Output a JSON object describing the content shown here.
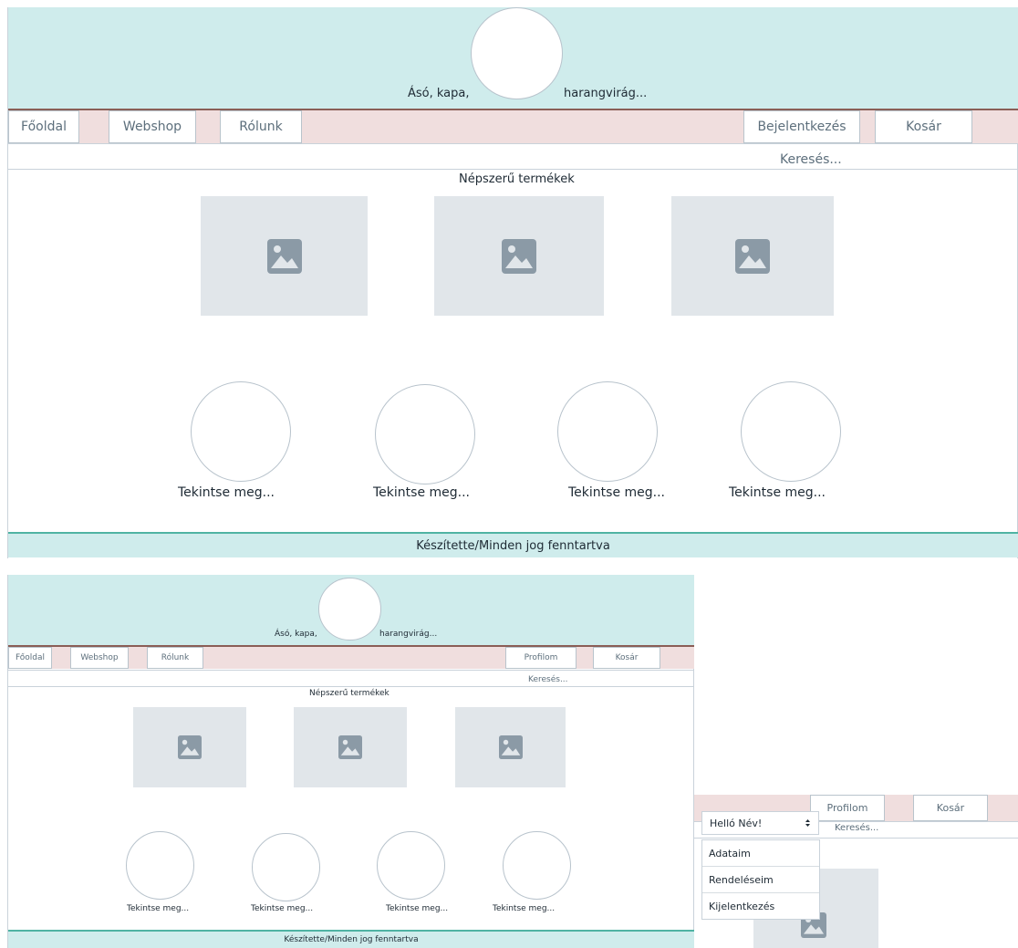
{
  "header": {
    "tagline_left": "Ásó, kapa,",
    "tagline_right": "harangvirág..."
  },
  "nav": {
    "home": "Főoldal",
    "webshop": "Webshop",
    "about": "Rólunk",
    "login": "Bejelentkezés",
    "profile": "Profilom",
    "cart": "Kosár"
  },
  "search": {
    "label": "Keresés..."
  },
  "section": {
    "popular_title": "Népszerű termékek"
  },
  "categories": [
    {
      "label": "Tekintse meg..."
    },
    {
      "label": "Tekintse meg..."
    },
    {
      "label": "Tekintse meg..."
    },
    {
      "label": "Tekintse meg..."
    }
  ],
  "footer": {
    "text": "Készítette/Minden jog fenntartva"
  },
  "user_menu": {
    "selected": "Helló Név!",
    "options": [
      "Adataim",
      "Rendeléseim",
      "Kijelentkezés"
    ]
  },
  "icons": {
    "product_image": "image-placeholder-icon",
    "dropdown": "select-arrows-icon"
  },
  "colors": {
    "header_bg": "#cfecec",
    "nav_bg": "#f0dede",
    "footer_border": "#4fb3a3"
  }
}
